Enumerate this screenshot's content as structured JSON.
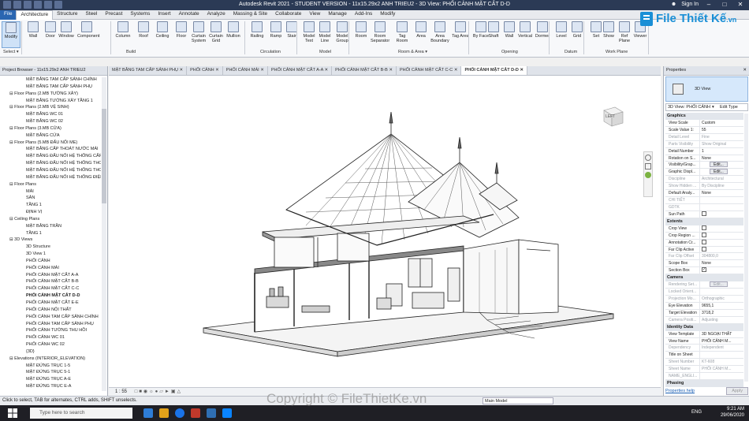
{
  "titlebar": {
    "title": "Autodesk Revit 2021 - STUDENT VERSION - 11x15.29x2 ANH TRIEU2 - 3D View: PHỐI CẢNH MẶT CẮT D-D",
    "sign_in": "Sign In"
  },
  "ribbon_tabs": [
    "File",
    "Architecture",
    "Structure",
    "Steel",
    "Precast",
    "Systems",
    "Insert",
    "Annotate",
    "Analyze",
    "Massing & Site",
    "Collaborate",
    "View",
    "Manage",
    "Add-Ins",
    "Modify"
  ],
  "ribbon_tools": [
    {
      "label": "Modify"
    },
    {
      "label": "Wall"
    },
    {
      "label": "Door"
    },
    {
      "label": "Window"
    },
    {
      "label": "Component"
    },
    {
      "label": "Column"
    },
    {
      "label": "Roof"
    },
    {
      "label": "Ceiling"
    },
    {
      "label": "Floor"
    },
    {
      "label": "Curtain System"
    },
    {
      "label": "Curtain Grid"
    },
    {
      "label": "Mullion"
    },
    {
      "label": "Railing"
    },
    {
      "label": "Ramp"
    },
    {
      "label": "Stair"
    },
    {
      "label": "Model Text"
    },
    {
      "label": "Model Line"
    },
    {
      "label": "Model Group"
    },
    {
      "label": "Room"
    },
    {
      "label": "Room Separator"
    },
    {
      "label": "Tag Room"
    },
    {
      "label": "Area"
    },
    {
      "label": "Area Boundary"
    },
    {
      "label": "Tag Area"
    },
    {
      "label": "By Face"
    },
    {
      "label": "Shaft"
    },
    {
      "label": "Wall"
    },
    {
      "label": "Vertical"
    },
    {
      "label": "Dormer"
    },
    {
      "label": "Level"
    },
    {
      "label": "Grid"
    },
    {
      "label": "Set"
    },
    {
      "label": "Show"
    },
    {
      "label": "Ref Plane"
    },
    {
      "label": "Viewer"
    }
  ],
  "ribbon_panels": [
    "Select ▾",
    "Build",
    "Circulation",
    "Model",
    "Room & Area ▾",
    "Opening",
    "Datum",
    "Work Plane"
  ],
  "project_browser": {
    "header": "Project Browser - 11x15.29x2 ANH TRIEU2",
    "items": [
      {
        "text": "MẶT BẰNG TAM CẤP SẢNH CHÍNH",
        "level": 1
      },
      {
        "text": "MẶT BẰNG TAM CẤP SẢNH PHỤ",
        "level": 1
      },
      {
        "text": "Floor Plans (2.MB TƯỜNG XÂY)",
        "level": 0
      },
      {
        "text": "MẶT BẰNG TƯỜNG XÂY TẦNG 1",
        "level": 1
      },
      {
        "text": "Floor Plans (2.MB VỆ SINH)",
        "level": 0
      },
      {
        "text": "MẶT BẰNG WC 01",
        "level": 1
      },
      {
        "text": "MẶT BẰNG WC 02",
        "level": 1
      },
      {
        "text": "Floor Plans (3.MB CỬA)",
        "level": 0
      },
      {
        "text": "MẶT BẰNG CỬA",
        "level": 1
      },
      {
        "text": "Floor Plans (5.MB ĐẤU NỐI ME)",
        "level": 0
      },
      {
        "text": "MẶT BẰNG CẤP THOÁT NƯỚC MÁI",
        "level": 1
      },
      {
        "text": "MẶT BẰNG ĐẤU NỐI HỆ THỐNG CẤP",
        "level": 1
      },
      {
        "text": "MẶT BẰNG ĐẤU NỐI HỆ THỐNG THOÁT",
        "level": 1
      },
      {
        "text": "MẶT BẰNG ĐẤU NỐI HỆ THỐNG THOÁT",
        "level": 1
      },
      {
        "text": "MẶT BẰNG ĐẤU NỐI HỆ THỐNG ĐIỆN",
        "level": 1
      },
      {
        "text": "Floor Plans",
        "level": 0
      },
      {
        "text": "MÁI",
        "level": 1
      },
      {
        "text": "SÂN",
        "level": 1
      },
      {
        "text": "TẦNG 1",
        "level": 1
      },
      {
        "text": "ĐỊNH VỊ",
        "level": 1
      },
      {
        "text": "Ceiling Plans",
        "level": 0
      },
      {
        "text": "MẶT BẰNG TRẦN",
        "level": 1
      },
      {
        "text": "TẦNG 1",
        "level": 1
      },
      {
        "text": "3D Views",
        "level": 0
      },
      {
        "text": "3D Structure",
        "level": 1
      },
      {
        "text": "3D View 1",
        "level": 1
      },
      {
        "text": "PHỐI CẢNH",
        "level": 1
      },
      {
        "text": "PHỐI CẢNH MÁI",
        "level": 1
      },
      {
        "text": "PHỐI CẢNH MẶT CẮT A-A",
        "level": 1
      },
      {
        "text": "PHỐI CẢNH MẶT CẮT B-B",
        "level": 1
      },
      {
        "text": "PHỐI CẢNH MẶT CẮT C-C",
        "level": 1
      },
      {
        "text": "PHỐI CẢNH MẶT CẮT D-D",
        "level": 1,
        "bold": true
      },
      {
        "text": "PHỐI CẢNH MẶT CẮT E-E",
        "level": 1
      },
      {
        "text": "PHỐI CẢNH NỘI THẤT",
        "level": 1
      },
      {
        "text": "PHỐI CẢNH TAM CẤP SẢNH CHÍNH",
        "level": 1
      },
      {
        "text": "PHỐI CẢNH TAM CẤP SẢNH PHỤ",
        "level": 1
      },
      {
        "text": "PHỐI CẢNH TƯỜNG THU HỒI",
        "level": 1
      },
      {
        "text": "PHỐI CẢNH WC 01",
        "level": 1
      },
      {
        "text": "PHỐI CẢNH WC 02",
        "level": 1
      },
      {
        "text": "{3D}",
        "level": 1
      },
      {
        "text": "Elevations (INTERIOR_ELEVATION)",
        "level": 0
      },
      {
        "text": "MẶT ĐỨNG TRỤC 1-5",
        "level": 1
      },
      {
        "text": "MẶT ĐỨNG TRỤC 5-1",
        "level": 1
      },
      {
        "text": "MẶT ĐỨNG TRỤC A-E",
        "level": 1
      },
      {
        "text": "MẶT ĐỨNG TRỤC E-A",
        "level": 1
      }
    ]
  },
  "view_tabs": [
    {
      "label": "MẶT BẰNG TAM CẤP SẢNH PHỤ"
    },
    {
      "label": "PHỐI CẢNH"
    },
    {
      "label": "PHỐI CẢNH MÁI"
    },
    {
      "label": "PHỐI CẢNH MẶT CẮT A-A"
    },
    {
      "label": "PHỐI CẢNH MẶT CẮT B-B"
    },
    {
      "label": "PHỐI CẢNH MẶT CẮT C-C"
    },
    {
      "label": "PHỐI CẢNH MẶT CẮT D-D",
      "active": true
    }
  ],
  "viewcube_label": "LEFT",
  "view_bar": {
    "scale": "1 : 55"
  },
  "properties": {
    "header": "Properties",
    "type_name": "3D View",
    "selector": "3D View: PHỐI CẢNH",
    "edit_type": "Edit Type",
    "rows": [
      {
        "section": "Graphics"
      },
      {
        "k": "View Scale",
        "v": "Custom"
      },
      {
        "k": "Scale Value 1:",
        "v": "55"
      },
      {
        "k": "Detail Level",
        "v": "Fine",
        "grey": true
      },
      {
        "k": "Parts Visibility",
        "v": "Show Original",
        "grey": true
      },
      {
        "k": "Detail Number",
        "v": "1"
      },
      {
        "k": "Rotation on S...",
        "v": "None"
      },
      {
        "k": "Visibility/Grap...",
        "v": "Edit...",
        "button": true
      },
      {
        "k": "Graphic Displ...",
        "v": "Edit...",
        "button": true
      },
      {
        "k": "Discipline",
        "v": "Architectural",
        "grey": true
      },
      {
        "k": "Show Hidden ...",
        "v": "By Discipline",
        "grey": true
      },
      {
        "k": "Default Analy...",
        "v": "None"
      },
      {
        "k": "CHI TIẾT",
        "v": "",
        "grey": true
      },
      {
        "k": "GDTK",
        "v": "",
        "grey": true
      },
      {
        "k": "Sun Path",
        "v": "",
        "checkbox": true
      },
      {
        "section": "Extents"
      },
      {
        "k": "Crop View",
        "v": "",
        "checkbox": true
      },
      {
        "k": "Crop Region ...",
        "v": "",
        "checkbox": true
      },
      {
        "k": "Annotation Cr...",
        "v": "",
        "checkbox": true
      },
      {
        "k": "Far Clip Active",
        "v": "",
        "checkbox": true
      },
      {
        "k": "Far Clip Offset",
        "v": "304800,0",
        "grey": true
      },
      {
        "k": "Scope Box",
        "v": "None"
      },
      {
        "k": "Section Box",
        "v": "✓",
        "checkbox": true
      },
      {
        "section": "Camera"
      },
      {
        "k": "Rendering Set...",
        "v": "Edit...",
        "grey": true,
        "button": true
      },
      {
        "k": "Locked Orient...",
        "v": "",
        "grey": true
      },
      {
        "k": "Projection Mo...",
        "v": "Orthographic",
        "grey": true
      },
      {
        "k": "Eye Elevation",
        "v": "9655,1"
      },
      {
        "k": "Target Elevation",
        "v": "3718,2"
      },
      {
        "k": "Camera Positi...",
        "v": "Adjusting",
        "grey": true
      },
      {
        "section": "Identity Data"
      },
      {
        "k": "View Template",
        "v": "3D NGOẠI THẤT"
      },
      {
        "k": "View Name",
        "v": "PHỐI CẢNH M..."
      },
      {
        "k": "Dependency",
        "v": "Independent",
        "grey": true
      },
      {
        "k": "Title on Sheet",
        "v": ""
      },
      {
        "k": "Sheet Number",
        "v": "KT-608",
        "grey": true
      },
      {
        "k": "Sheet Name",
        "v": "PHỐI CẢNH M...",
        "grey": true
      },
      {
        "k": "NAME_ENGLI...",
        "v": "",
        "grey": true
      },
      {
        "section": "Phasing"
      }
    ],
    "help_link": "Properties help",
    "apply": "Apply"
  },
  "status": {
    "text": "Click to select, TAB for alternates, CTRL adds, SHIFT unselects.",
    "main_model": "Main Model"
  },
  "taskbar": {
    "search": "Type here to search",
    "lang": "ENG",
    "time": "9:21 AM",
    "date": "29/06/2020"
  },
  "watermark": {
    "logo": "File Thiết Kế",
    "logo_suffix": ".vn",
    "copyright": "Copyright © FileThietKe.vn"
  },
  "colors": {
    "title_bar": "#2b3a55",
    "file_tab": "#2a66b1",
    "selection": "#d6e8fb",
    "logo_blue": "#1a8fd6"
  }
}
